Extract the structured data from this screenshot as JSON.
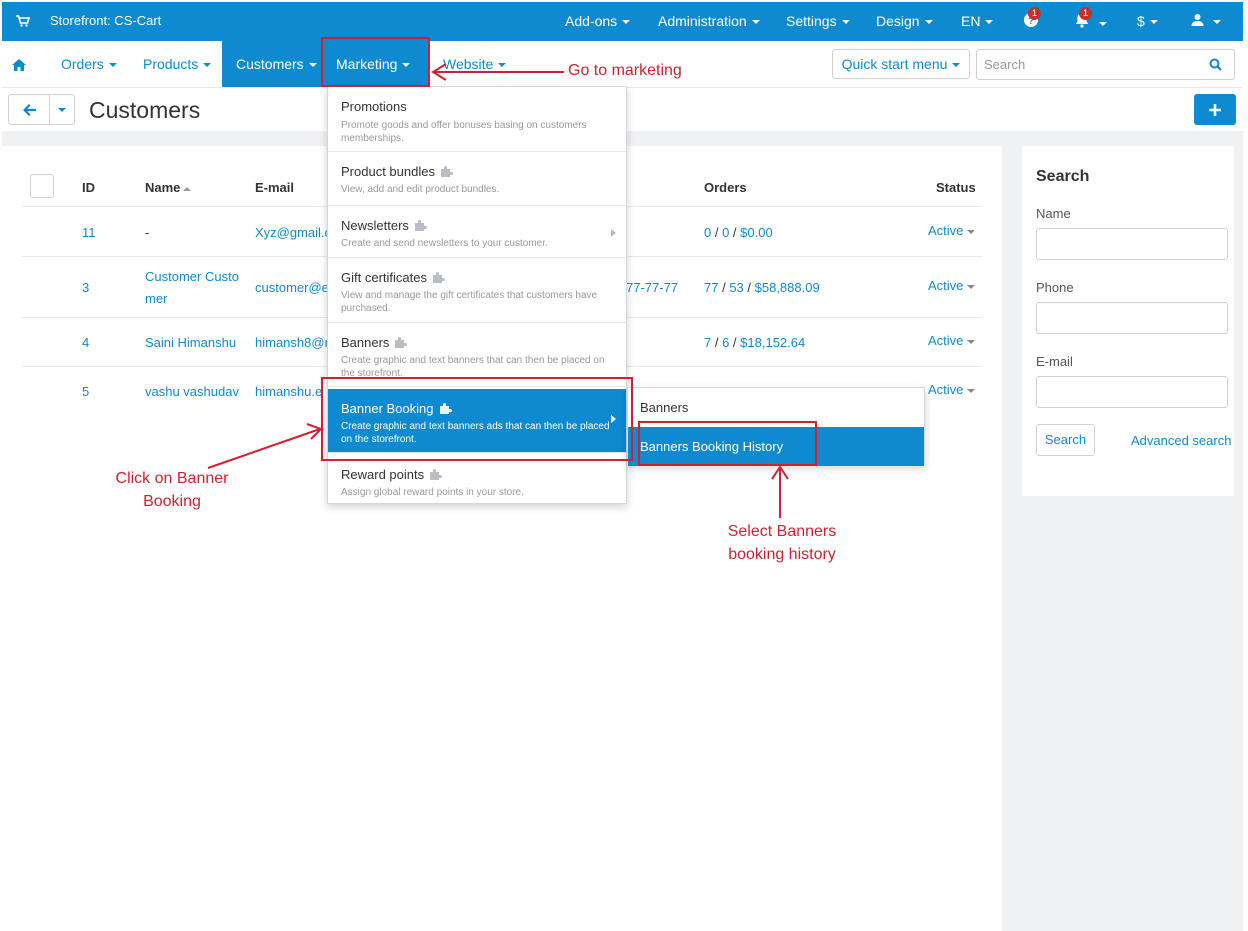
{
  "topbar": {
    "store_name": "Storefront: CS-Cart",
    "menu": [
      "Add-ons",
      "Administration",
      "Settings",
      "Design",
      "EN"
    ],
    "help_badge": "1",
    "notifications_badge": "1",
    "currency": "$"
  },
  "nav": {
    "items": [
      "Orders",
      "Products",
      "Customers",
      "Marketing",
      "Website"
    ],
    "quick_start": "Quick start menu",
    "search_placeholder": "Search"
  },
  "page": {
    "title": "Customers"
  },
  "table": {
    "headers": {
      "id": "ID",
      "name": "Name",
      "email": "E-mail",
      "orders": "Orders",
      "status": "Status"
    },
    "rows": [
      {
        "id": "11",
        "name": "-",
        "email": "Xyz@gmail.c",
        "phone": "",
        "orders_a": "0",
        "orders_b": "0",
        "orders_total": "$0.00",
        "status": "Active"
      },
      {
        "id": "3",
        "name_line1": "Customer Custo",
        "name_line2": "mer",
        "email": "customer@e",
        "phone": "77-77-77",
        "orders_a": "77",
        "orders_b": "53",
        "orders_total": "$58,888.09",
        "status": "Active"
      },
      {
        "id": "4",
        "name": "Saini Himanshu",
        "email": "himansh8@r",
        "phone": "",
        "orders_a": "7",
        "orders_b": "6",
        "orders_total": "$18,152.64",
        "status": "Active"
      },
      {
        "id": "5",
        "name": "vashu vashudav",
        "email": "himanshu.e",
        "phone": "",
        "status": "Active"
      }
    ]
  },
  "sidebar": {
    "title": "Search",
    "name_label": "Name",
    "phone_label": "Phone",
    "email_label": "E-mail",
    "search_button": "Search",
    "advanced_link": "Advanced search"
  },
  "marketing_menu": [
    {
      "title": "Promotions",
      "desc": "Promote goods and offer bonuses basing on customers memberships."
    },
    {
      "title": "Product bundles",
      "desc": "View, add and edit product bundles."
    },
    {
      "title": "Newsletters",
      "desc": "Create and send newsletters to your customer."
    },
    {
      "title": "Gift certificates",
      "desc": "View and manage the gift certificates that customers have purchased."
    },
    {
      "title": "Banners",
      "desc": "Create graphic and text banners that can then be placed on the storefront."
    },
    {
      "title": "Banner Booking",
      "desc": "Create graphic and text banners ads that can then be placed on the storefront."
    },
    {
      "title": "Reward points",
      "desc": "Assign global reward points in your store."
    }
  ],
  "submenu": [
    "Banners",
    "Banners Booking History"
  ],
  "annotations": {
    "go_marketing": "Go to marketing",
    "click_banner_line1": "Click on Banner",
    "click_banner_line2": "Booking",
    "select_history_line1": "Select Banners",
    "select_history_line2": "booking history"
  },
  "colors": {
    "primary": "#0d8ad0",
    "annotation": "#d1202f",
    "background": "#f0f1f3"
  }
}
